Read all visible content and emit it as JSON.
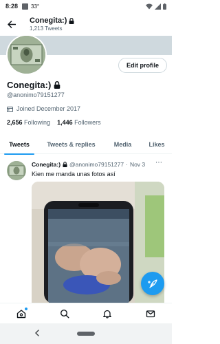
{
  "status": {
    "time": "8:28",
    "temperature": "33°"
  },
  "header": {
    "name": "Conegita:)",
    "tweet_count": "1,213 Tweets",
    "back_icon": "arrow-left-icon"
  },
  "profile": {
    "edit_label": "Edit profile",
    "display_name": "Conegita:)",
    "handle": "@anonimo79151277",
    "joined": "Joined December 2017",
    "following_count": "2,656",
    "following_label": "Following",
    "followers_count": "1,446",
    "followers_label": "Followers"
  },
  "tabs": [
    {
      "label": "Tweets",
      "active": true
    },
    {
      "label": "Tweets & replies",
      "active": false
    },
    {
      "label": "Media",
      "active": false
    },
    {
      "label": "Likes",
      "active": false
    }
  ],
  "tweet": {
    "name": "Conegita:)",
    "handle": "@anonimo79151277",
    "separator": "·",
    "date": "Nov 3",
    "text": "Kien me manda unas fotos así",
    "more": "⋯"
  },
  "bottom_nav": [
    "home-icon",
    "search-icon",
    "bell-icon",
    "mail-icon"
  ],
  "colors": {
    "accent": "#1d9bf0",
    "text": "#0f1419",
    "muted": "#536471",
    "banner": "#cfd9de"
  }
}
